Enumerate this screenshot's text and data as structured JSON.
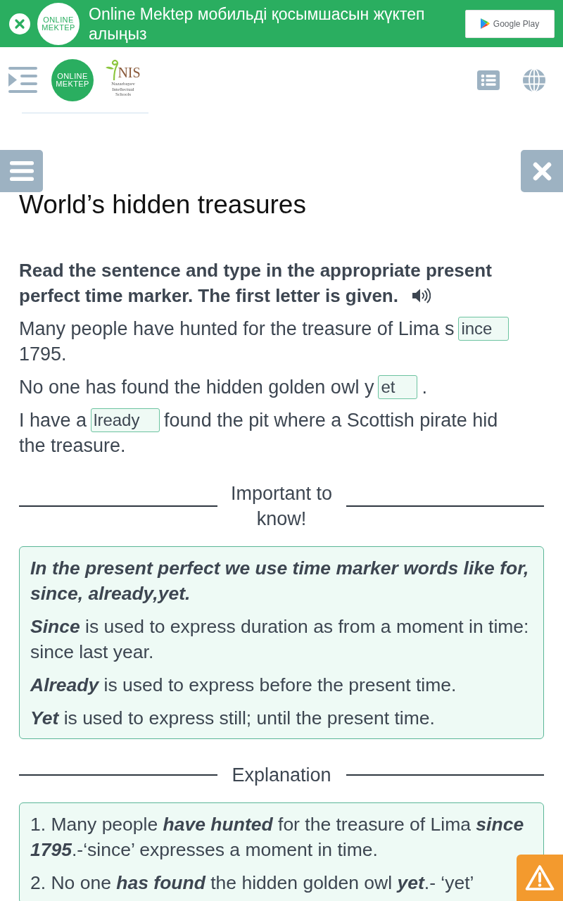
{
  "app_banner": {
    "logo_text": "ONLINE MEKTEP",
    "message": "Online Mektep мобильді қосымшасын жүктеп алыңыз",
    "store_button": "Google Play"
  },
  "header": {
    "logo_text": "ONLINE MEKTEP",
    "partner_logo": {
      "mark": "NIS",
      "caption": "Nazarbayev Intellectual Schools"
    }
  },
  "lesson": {
    "title": "World’s hidden treasures",
    "instruction_lines": [
      "Read the sentence and type in the appropriate present",
      "perfect time marker. The first letter is given."
    ],
    "sentences": [
      {
        "parts": [
          {
            "kind": "text",
            "text": "Many people have hunted for the treasure of Lima s"
          },
          {
            "kind": "input",
            "value": "ince"
          },
          {
            "kind": "text",
            "text": "1795."
          }
        ]
      },
      {
        "parts": [
          {
            "kind": "text",
            "text": "No one has found the hidden golden owl y"
          },
          {
            "kind": "input",
            "value": "et"
          },
          {
            "kind": "text",
            "text": "."
          }
        ]
      },
      {
        "parts": [
          {
            "kind": "text",
            "text": "I have a"
          },
          {
            "kind": "input",
            "value": "lready"
          },
          {
            "kind": "text",
            "text": "found the pit where a Scottish pirate hid"
          },
          {
            "kind": "text",
            "text": "the treasure."
          }
        ]
      }
    ]
  },
  "important": {
    "heading": "Important to know!",
    "lead": "In the present perfect we use time marker words like for, since, already,yet.",
    "paragraphs": [
      "**Since** is used to express duration as from a moment in time: since last year.",
      "**Already** is used to express before the present time.",
      "**Yet** is used to express still; until the present time."
    ]
  },
  "explanation": {
    "heading": "Explanation",
    "items": [
      "1. Many people **have hunted** for the treasure of Lima **since 1795**.-‘since’ expresses a moment in time.",
      "2. No one **has found** the hidden golden owl **yet**.- ‘yet’"
    ]
  }
}
